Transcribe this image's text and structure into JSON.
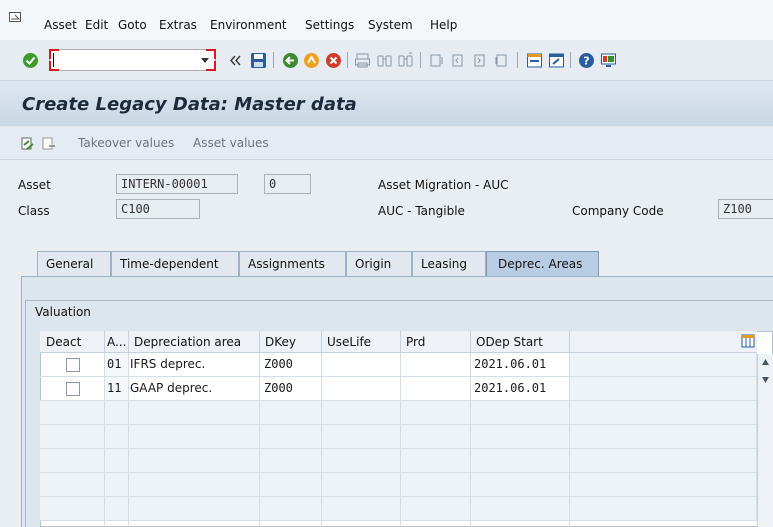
{
  "menubar": {
    "items": [
      "Asset",
      "Edit",
      "Goto",
      "Extras",
      "Environment",
      "Settings",
      "System",
      "Help"
    ]
  },
  "toolbar": {
    "command_value": "",
    "icons": [
      "check-icon",
      "dropdown-icon",
      "double-chevron-left-icon",
      "save-icon",
      "back-icon",
      "exit-icon",
      "cancel-icon",
      "print-icon",
      "find-icon",
      "find-next-icon",
      "first-page-icon",
      "previous-page-icon",
      "next-page-icon",
      "last-page-icon",
      "create-session-icon",
      "shortcut-icon",
      "help-icon",
      "customize-layout-icon"
    ]
  },
  "page": {
    "title": "Create Legacy Data: Master data"
  },
  "app_toolbar": {
    "takeover_label": "Takeover values",
    "asset_values_label": "Asset values"
  },
  "header": {
    "asset_label": "Asset",
    "asset_value": "INTERN-00001",
    "subnumber_value": "0",
    "asset_description": "Asset Migration - AUC",
    "class_label": "Class",
    "class_value": "C100",
    "class_description": "AUC - Tangible",
    "company_code_label": "Company Code",
    "company_code_value": "Z100"
  },
  "tabs": [
    {
      "label": "General",
      "active": false
    },
    {
      "label": "Time-dependent",
      "active": false
    },
    {
      "label": "Assignments",
      "active": false
    },
    {
      "label": "Origin",
      "active": false
    },
    {
      "label": "Leasing",
      "active": false
    },
    {
      "label": "Deprec. Areas",
      "active": true
    }
  ],
  "valuation": {
    "group_title": "Valuation",
    "columns": [
      "Deact",
      "A...",
      "Depreciation area",
      "DKey",
      "UseLife",
      "Prd",
      "ODep Start"
    ],
    "rows": [
      {
        "deact": false,
        "area": "01",
        "name": "IFRS deprec.",
        "dkey": "Z000",
        "uselife": "",
        "prd": "",
        "odep_start": "2021.06.01"
      },
      {
        "deact": false,
        "area": "11",
        "name": "GAAP deprec.",
        "dkey": "Z000",
        "uselife": "",
        "prd": "",
        "odep_start": "2021.06.01"
      }
    ]
  }
}
